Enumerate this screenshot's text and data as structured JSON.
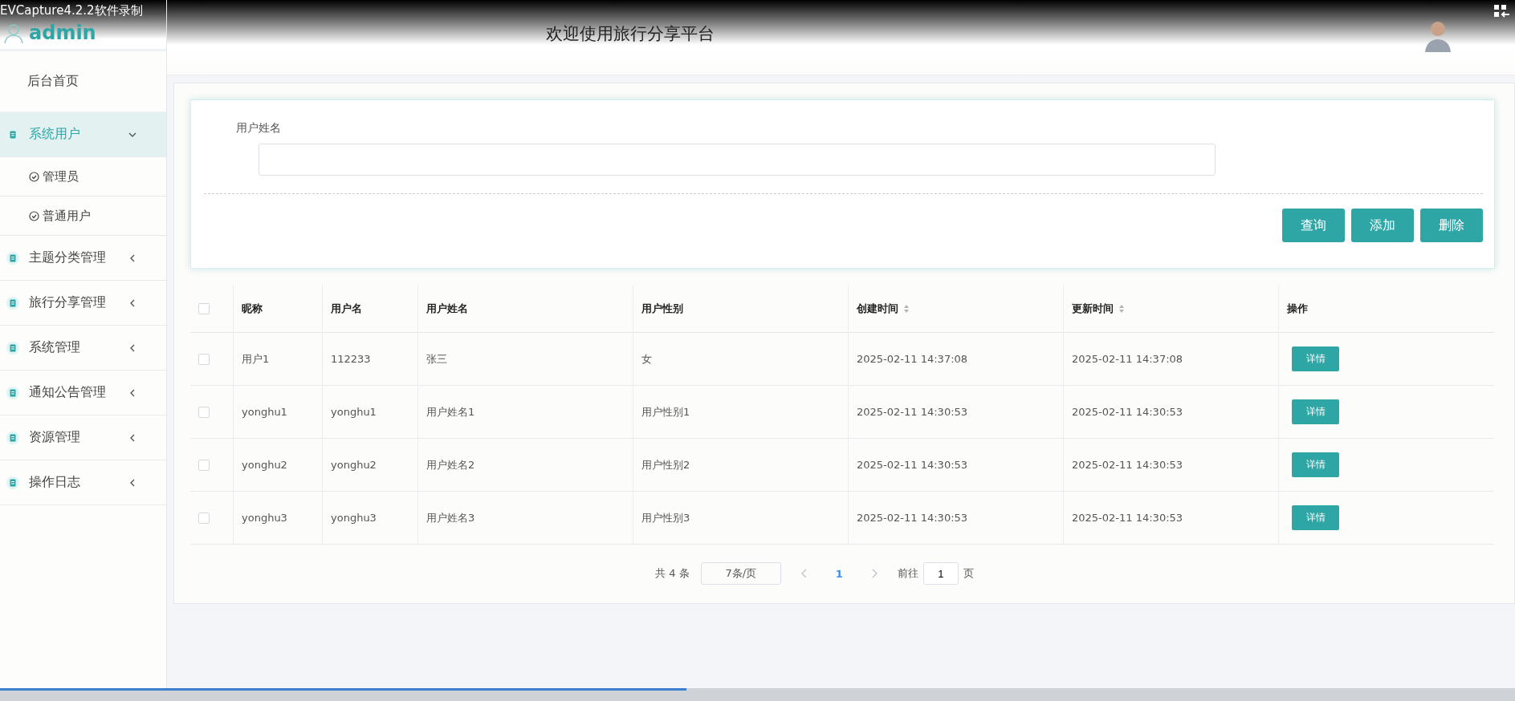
{
  "recorder": {
    "title": "EVCapture4.2.2软件录制",
    "progress": {
      "level": 0.453
    }
  },
  "sidebar": {
    "user": "admin",
    "items": [
      {
        "label": "后台首页",
        "kind": "link"
      },
      {
        "label": "系统用户",
        "kind": "menu",
        "expanded": true,
        "children": [
          {
            "label": "管理员",
            "selected": false
          },
          {
            "label": "普通用户",
            "selected": false
          }
        ]
      },
      {
        "label": "主题分类管理",
        "kind": "menu",
        "expanded": false
      },
      {
        "label": "旅行分享管理",
        "kind": "menu",
        "expanded": false
      },
      {
        "label": "系统管理",
        "kind": "menu",
        "expanded": false
      },
      {
        "label": "通知公告管理",
        "kind": "menu",
        "expanded": false
      },
      {
        "label": "资源管理",
        "kind": "menu",
        "expanded": false
      },
      {
        "label": "操作日志",
        "kind": "menu",
        "expanded": false
      }
    ]
  },
  "header": {
    "title": "欢迎使用旅行分享平台"
  },
  "search": {
    "label": "用户姓名",
    "buttons": [
      "查询",
      "添加",
      "删除"
    ]
  },
  "table": {
    "select_all": {
      "checked": false
    },
    "columns": [
      {
        "label": "昵称",
        "sortable": false
      },
      {
        "label": "用户名",
        "sortable": false
      },
      {
        "label": "用户姓名",
        "sortable": false
      },
      {
        "label": "用户性别",
        "sortable": false
      },
      {
        "label": "创建时间",
        "sortable": true
      },
      {
        "label": "更新时间",
        "sortable": true
      },
      {
        "label": "操作",
        "sortable": false
      }
    ],
    "rows": [
      {
        "checked": false,
        "cells": [
          "用户1",
          "112233",
          "张三",
          "女",
          "2025-02-11 14:37:08",
          "2025-02-11 14:37:08"
        ],
        "action": "详情"
      },
      {
        "checked": false,
        "cells": [
          "yonghu1",
          "yonghu1",
          "用户姓名1",
          "用户性别1",
          "2025-02-11 14:30:53",
          "2025-02-11 14:30:53"
        ],
        "action": "详情"
      },
      {
        "checked": false,
        "cells": [
          "yonghu2",
          "yonghu2",
          "用户姓名2",
          "用户性别2",
          "2025-02-11 14:30:53",
          "2025-02-11 14:30:53"
        ],
        "action": "详情"
      },
      {
        "checked": false,
        "cells": [
          "yonghu3",
          "yonghu3",
          "用户姓名3",
          "用户性别3",
          "2025-02-11 14:30:53",
          "2025-02-11 14:30:53"
        ],
        "action": "详情"
      }
    ]
  },
  "pagination": {
    "total": "共 4 条",
    "page_size": "7条/页",
    "pages": [
      {
        "label": "1",
        "selected": true
      }
    ],
    "goto_label": "前往",
    "goto_value": "1",
    "goto_suffix": "页"
  }
}
